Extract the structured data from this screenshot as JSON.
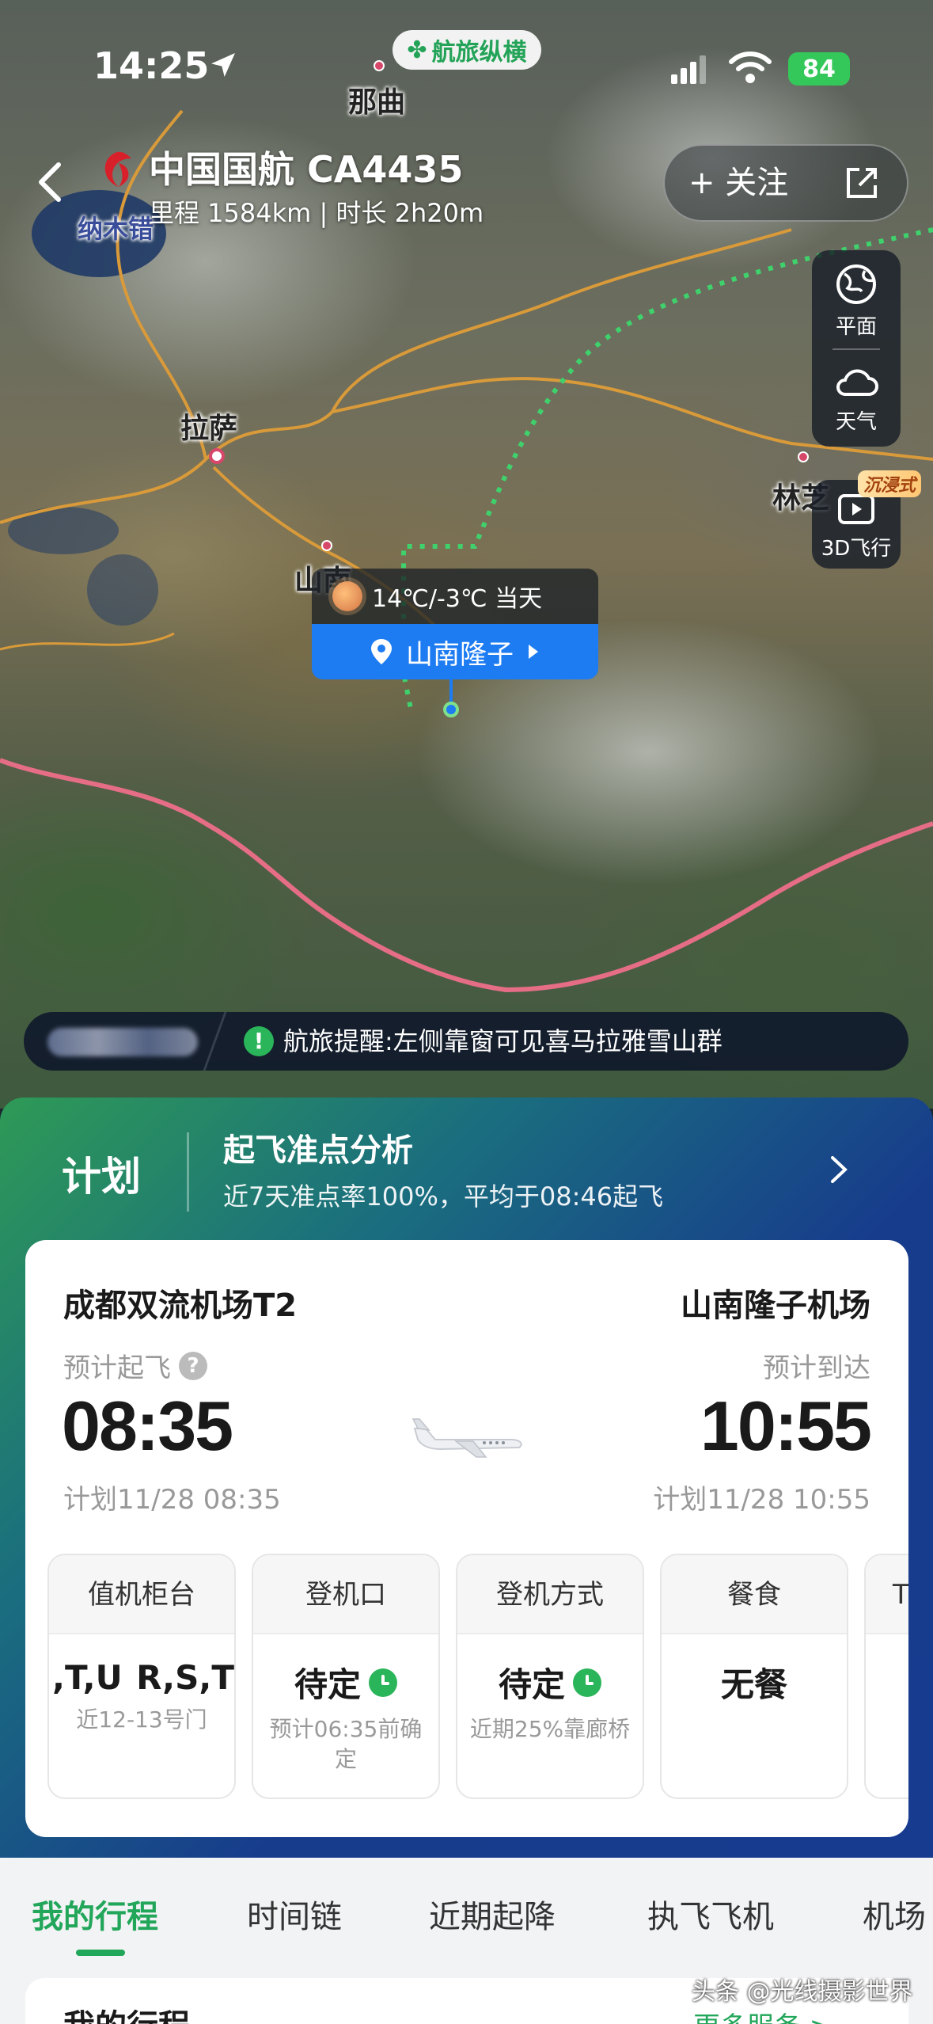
{
  "status_bar": {
    "time": "14:25",
    "brand": "航旅纵横",
    "battery": "84"
  },
  "header": {
    "title": "中国国航  CA4435",
    "meta": "里程 1584km | 时长 2h20m",
    "follow_label": "+ 关注"
  },
  "map": {
    "labels": {
      "naqu": "那曲",
      "namtso": "纳木错",
      "lhasa": "拉萨",
      "shannan": "山南",
      "linzhi": "林芝"
    },
    "tools": {
      "flat": "平面",
      "weather": "天气",
      "flight3d": "3D飞行",
      "immersive": "沉浸式"
    },
    "weather": "14℃/-3℃ 当天",
    "destination": "山南隆子",
    "reminder_text": "航旅提醒:左侧靠窗可见喜马拉雅雪山群"
  },
  "plan": {
    "tab": "计划",
    "punctuality_title": "起飞准点分析",
    "punctuality_sub": "近7天准点率100%，平均于08:46起飞"
  },
  "flight": {
    "dep_airport": "成都双流机场T2",
    "arr_airport": "山南隆子机场",
    "dep_label": "预计起飞",
    "arr_label": "预计到达",
    "dep_time": "08:35",
    "arr_time": "10:55",
    "dep_sched": "计划11/28 08:35",
    "arr_sched": "计划11/28 10:55"
  },
  "info_cards": [
    {
      "head": "值机柜台",
      "value_left": ",T,U",
      "value_right": "R,S,T",
      "note": "近12-13号门"
    },
    {
      "head": "登机口",
      "value": "待定",
      "note": "预计06:35前确定"
    },
    {
      "head": "登机方式",
      "value": "待定",
      "note": "近期25%靠廊桥"
    },
    {
      "head": "餐食",
      "value": "无餐",
      "note": ""
    },
    {
      "head": "T",
      "value": "",
      "note": ""
    }
  ],
  "tabs": [
    "我的行程",
    "时间链",
    "近期起降",
    "执飞飞机",
    "机场"
  ],
  "trip": {
    "title": "我的行程",
    "more": "更多服务 >"
  },
  "watermark": "头条 @光线摄影世界",
  "colors": {
    "accent_green": "#22a65a",
    "accent_blue": "#1e7cf2",
    "airline_red": "#d7202a"
  }
}
